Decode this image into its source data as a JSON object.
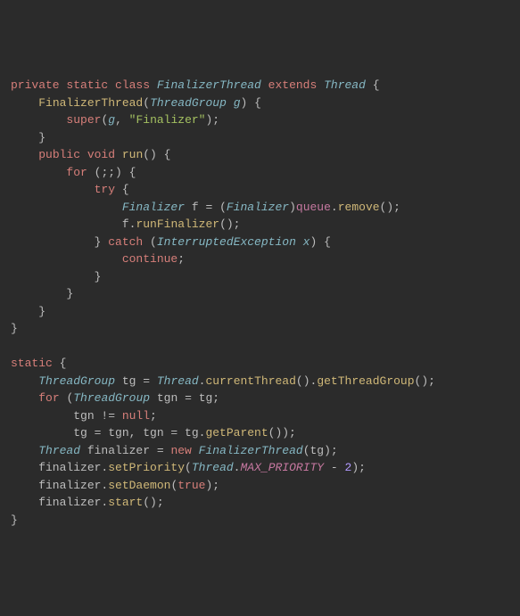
{
  "lines": [
    [
      {
        "t": "private ",
        "c": "kw"
      },
      {
        "t": "static ",
        "c": "kw"
      },
      {
        "t": "class ",
        "c": "kw"
      },
      {
        "t": "FinalizerThread ",
        "c": "type"
      },
      {
        "t": "extends ",
        "c": "kw"
      },
      {
        "t": "Thread ",
        "c": "type"
      },
      {
        "t": "{",
        "c": "punc"
      }
    ],
    [
      {
        "t": "    ",
        "c": "punc"
      },
      {
        "t": "FinalizerThread",
        "c": "meth"
      },
      {
        "t": "(",
        "c": "punc"
      },
      {
        "t": "ThreadGroup ",
        "c": "type"
      },
      {
        "t": "g",
        "c": "param"
      },
      {
        "t": ") {",
        "c": "punc"
      }
    ],
    [
      {
        "t": "        ",
        "c": "punc"
      },
      {
        "t": "super",
        "c": "kw"
      },
      {
        "t": "(",
        "c": "punc"
      },
      {
        "t": "g",
        "c": "param"
      },
      {
        "t": ", ",
        "c": "punc"
      },
      {
        "t": "\"Finalizer\"",
        "c": "str"
      },
      {
        "t": ");",
        "c": "punc"
      }
    ],
    [
      {
        "t": "    }",
        "c": "punc"
      }
    ],
    [
      {
        "t": "    ",
        "c": "punc"
      },
      {
        "t": "public ",
        "c": "kw"
      },
      {
        "t": "void ",
        "c": "kw"
      },
      {
        "t": "run",
        "c": "meth"
      },
      {
        "t": "() {",
        "c": "punc"
      }
    ],
    [
      {
        "t": "        ",
        "c": "punc"
      },
      {
        "t": "for ",
        "c": "kw"
      },
      {
        "t": "(;;) {",
        "c": "punc"
      }
    ],
    [
      {
        "t": "            ",
        "c": "punc"
      },
      {
        "t": "try ",
        "c": "kw"
      },
      {
        "t": "{",
        "c": "punc"
      }
    ],
    [
      {
        "t": "                ",
        "c": "punc"
      },
      {
        "t": "Finalizer ",
        "c": "type"
      },
      {
        "t": "f ",
        "c": "id"
      },
      {
        "t": "= ",
        "c": "punc"
      },
      {
        "t": "(",
        "c": "punc"
      },
      {
        "t": "Finalizer",
        "c": "type"
      },
      {
        "t": ")",
        "c": "punc"
      },
      {
        "t": "queue",
        "c": "field"
      },
      {
        "t": ".",
        "c": "punc"
      },
      {
        "t": "remove",
        "c": "meth"
      },
      {
        "t": "();",
        "c": "punc"
      }
    ],
    [
      {
        "t": "                f.",
        "c": "punc"
      },
      {
        "t": "runFinalizer",
        "c": "meth"
      },
      {
        "t": "();",
        "c": "punc"
      }
    ],
    [
      {
        "t": "            } ",
        "c": "punc"
      },
      {
        "t": "catch ",
        "c": "kw"
      },
      {
        "t": "(",
        "c": "punc"
      },
      {
        "t": "InterruptedException ",
        "c": "type"
      },
      {
        "t": "x",
        "c": "param"
      },
      {
        "t": ") {",
        "c": "punc"
      }
    ],
    [
      {
        "t": "                ",
        "c": "punc"
      },
      {
        "t": "continue",
        "c": "kw"
      },
      {
        "t": ";",
        "c": "punc"
      }
    ],
    [
      {
        "t": "            }",
        "c": "punc"
      }
    ],
    [
      {
        "t": "        }",
        "c": "punc"
      }
    ],
    [
      {
        "t": "    }",
        "c": "punc"
      }
    ],
    [
      {
        "t": "}",
        "c": "punc"
      }
    ],
    [
      {
        "t": " ",
        "c": "punc"
      }
    ],
    [
      {
        "t": "static ",
        "c": "kw"
      },
      {
        "t": "{",
        "c": "punc"
      }
    ],
    [
      {
        "t": "    ",
        "c": "punc"
      },
      {
        "t": "ThreadGroup ",
        "c": "type"
      },
      {
        "t": "tg ",
        "c": "id"
      },
      {
        "t": "= ",
        "c": "punc"
      },
      {
        "t": "Thread",
        "c": "type"
      },
      {
        "t": ".",
        "c": "punc"
      },
      {
        "t": "currentThread",
        "c": "meth"
      },
      {
        "t": "().",
        "c": "punc"
      },
      {
        "t": "getThreadGroup",
        "c": "meth"
      },
      {
        "t": "();",
        "c": "punc"
      }
    ],
    [
      {
        "t": "    ",
        "c": "punc"
      },
      {
        "t": "for ",
        "c": "kw"
      },
      {
        "t": "(",
        "c": "punc"
      },
      {
        "t": "ThreadGroup ",
        "c": "type"
      },
      {
        "t": "tgn ",
        "c": "id"
      },
      {
        "t": "= tg;",
        "c": "punc"
      }
    ],
    [
      {
        "t": "         tgn ",
        "c": "punc"
      },
      {
        "t": "!= ",
        "c": "punc"
      },
      {
        "t": "null",
        "c": "kw"
      },
      {
        "t": ";",
        "c": "punc"
      }
    ],
    [
      {
        "t": "         tg = tgn, tgn = tg.",
        "c": "punc"
      },
      {
        "t": "getParent",
        "c": "meth"
      },
      {
        "t": "());",
        "c": "punc"
      }
    ],
    [
      {
        "t": "    ",
        "c": "punc"
      },
      {
        "t": "Thread ",
        "c": "type"
      },
      {
        "t": "finalizer ",
        "c": "id"
      },
      {
        "t": "= ",
        "c": "punc"
      },
      {
        "t": "new ",
        "c": "kw"
      },
      {
        "t": "FinalizerThread",
        "c": "type"
      },
      {
        "t": "(tg);",
        "c": "punc"
      }
    ],
    [
      {
        "t": "    finalizer.",
        "c": "punc"
      },
      {
        "t": "setPriority",
        "c": "meth"
      },
      {
        "t": "(",
        "c": "punc"
      },
      {
        "t": "Thread",
        "c": "type"
      },
      {
        "t": ".",
        "c": "punc"
      },
      {
        "t": "MAX_PRIORITY ",
        "c": "const"
      },
      {
        "t": "- ",
        "c": "punc"
      },
      {
        "t": "2",
        "c": "num"
      },
      {
        "t": ");",
        "c": "punc"
      }
    ],
    [
      {
        "t": "    finalizer.",
        "c": "punc"
      },
      {
        "t": "setDaemon",
        "c": "meth"
      },
      {
        "t": "(",
        "c": "punc"
      },
      {
        "t": "true",
        "c": "kw"
      },
      {
        "t": ");",
        "c": "punc"
      }
    ],
    [
      {
        "t": "    finalizer.",
        "c": "punc"
      },
      {
        "t": "start",
        "c": "meth"
      },
      {
        "t": "();",
        "c": "punc"
      }
    ],
    [
      {
        "t": "}",
        "c": "punc"
      }
    ]
  ]
}
